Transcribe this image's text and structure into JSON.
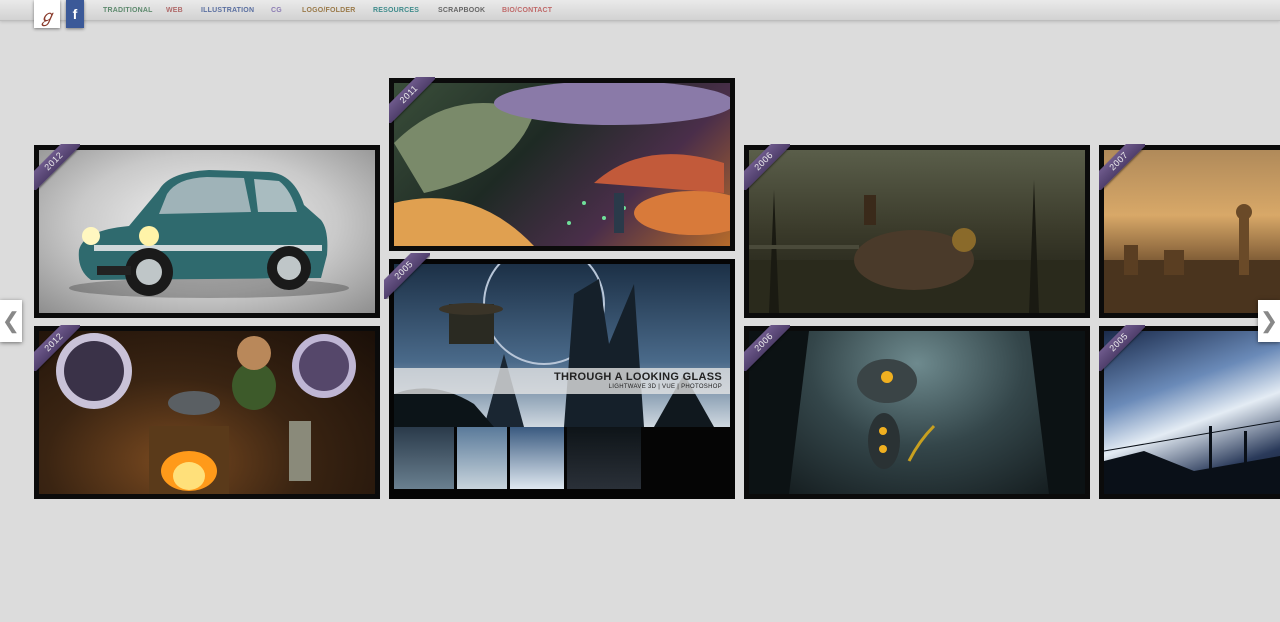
{
  "header": {
    "logo_glyph": "ℊ",
    "facebook_glyph": "f",
    "nav": [
      {
        "label": "TRADITIONAL",
        "color": "#5e8a6e"
      },
      {
        "label": "WEB",
        "color": "#b06a6a"
      },
      {
        "label": "ILLUSTRATION",
        "color": "#5a6fa0"
      },
      {
        "label": "CG",
        "color": "#8c7cb4"
      },
      {
        "label": "LOGO/FOLDER",
        "color": "#9a7a4a"
      },
      {
        "label": "RESOURCES",
        "color": "#3f8c8c"
      },
      {
        "label": "SCRAPBOOK",
        "color": "#666666"
      },
      {
        "label": "BIO/CONTACT",
        "color": "#c06a6a"
      }
    ]
  },
  "carousel": {
    "prev_glyph": "❮",
    "next_glyph": "❯"
  },
  "tiles": [
    {
      "year": "2012"
    },
    {
      "year": "2012"
    },
    {
      "year": "2011"
    },
    {
      "year": "2005",
      "caption_title": "THROUGH A LOOKING GLASS",
      "caption_sub": "LIGHTWAVE 3D | VUE | PHOTOSHOP"
    },
    {
      "year": "2006"
    },
    {
      "year": "2006"
    },
    {
      "year": "2007"
    },
    {
      "year": "2005"
    }
  ]
}
